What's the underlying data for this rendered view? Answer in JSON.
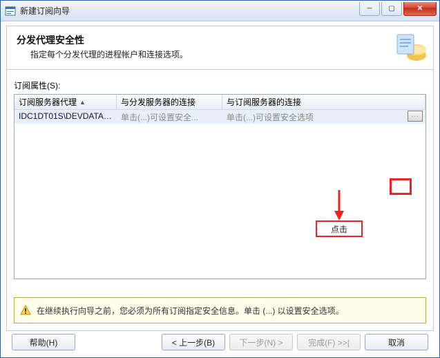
{
  "window": {
    "title": "新建订阅向导"
  },
  "header": {
    "title": "分发代理安全性",
    "subtitle": "指定每个分发代理的进程帐户和连接选项。"
  },
  "properties": {
    "label": "订阅属性(S):",
    "columns": {
      "agent": "订阅服务器代理",
      "dist_conn": "与分发服务器的连接",
      "sub_conn": "与订阅服务器的连接"
    },
    "row": {
      "agent": "IDC1DT01S\\DEVDATAB...",
      "dist_conn": "单击(...)可设置安全...",
      "sub_conn": "单击(...)可设置安全选项",
      "ellipsis": "..."
    }
  },
  "annotation": {
    "label": "点击"
  },
  "warning": {
    "text": "在继续执行向导之前，您必须为所有订阅指定安全信息。单击 (...) 以设置安全选项。"
  },
  "buttons": {
    "help": "帮助(H)",
    "back": "< 上一步(B)",
    "next": "下一步(N) >",
    "finish": "完成(F) >>|",
    "cancel": "取消"
  }
}
